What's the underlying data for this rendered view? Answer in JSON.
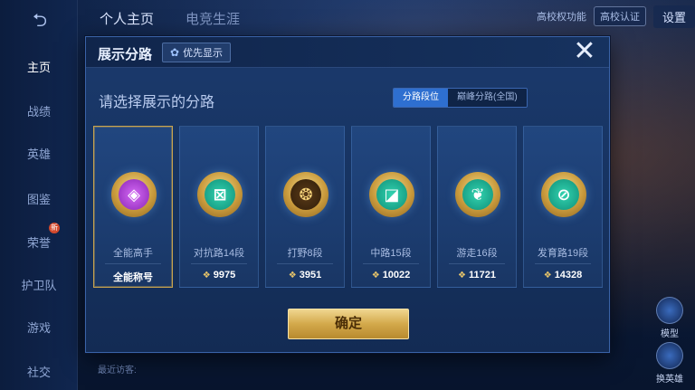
{
  "background": {
    "nav_items": [
      {
        "label": "主页",
        "active": true
      },
      {
        "label": "战绩",
        "active": false
      },
      {
        "label": "英雄",
        "active": false
      },
      {
        "label": "图鉴",
        "active": false
      },
      {
        "label": "荣誉",
        "active": false
      },
      {
        "label": "护卫队",
        "active": false
      },
      {
        "label": "游戏",
        "active": false
      },
      {
        "label": "社交",
        "active": false
      }
    ],
    "nav_badge": "新",
    "tabs": [
      "个人主页",
      "电竞生涯"
    ],
    "top_right": {
      "feature_text": "高校权功能",
      "verify_label": "高校认证",
      "settings_label": "设置"
    },
    "recent_visitors": "最近访客:",
    "right_buttons": [
      {
        "label": "模型"
      },
      {
        "label": "换英雄"
      }
    ]
  },
  "dialog": {
    "title": "展示分路",
    "priority_button": "优先显示",
    "close_icon": "close-icon",
    "prompt": "请选择展示的分路",
    "tabs": [
      {
        "label": "分路段位",
        "active": true
      },
      {
        "label": "巅峰分路(全国)",
        "active": false
      }
    ],
    "cards": [
      {
        "name": "全能高手",
        "value": "全能称号",
        "emblem": "purple",
        "glyph": "◈",
        "selected": true,
        "show_diamond": false
      },
      {
        "name": "对抗路14段",
        "value": "9975",
        "emblem": "green",
        "glyph": "⊠",
        "selected": false,
        "show_diamond": true
      },
      {
        "name": "打野8段",
        "value": "3951",
        "emblem": "gold",
        "glyph": "❂",
        "selected": false,
        "show_diamond": true
      },
      {
        "name": "中路15段",
        "value": "10022",
        "emblem": "green",
        "glyph": "◪",
        "selected": false,
        "show_diamond": true
      },
      {
        "name": "游走16段",
        "value": "11721",
        "emblem": "green",
        "glyph": "❦",
        "selected": false,
        "show_diamond": true
      },
      {
        "name": "发育路19段",
        "value": "14328",
        "emblem": "green",
        "glyph": "⊘",
        "selected": false,
        "show_diamond": true
      }
    ],
    "confirm_label": "确定"
  },
  "colors": {
    "dialog_bg": "#1b3a6d",
    "accent_gold": "#d3a94b",
    "active_tab": "#2e6fd0"
  }
}
